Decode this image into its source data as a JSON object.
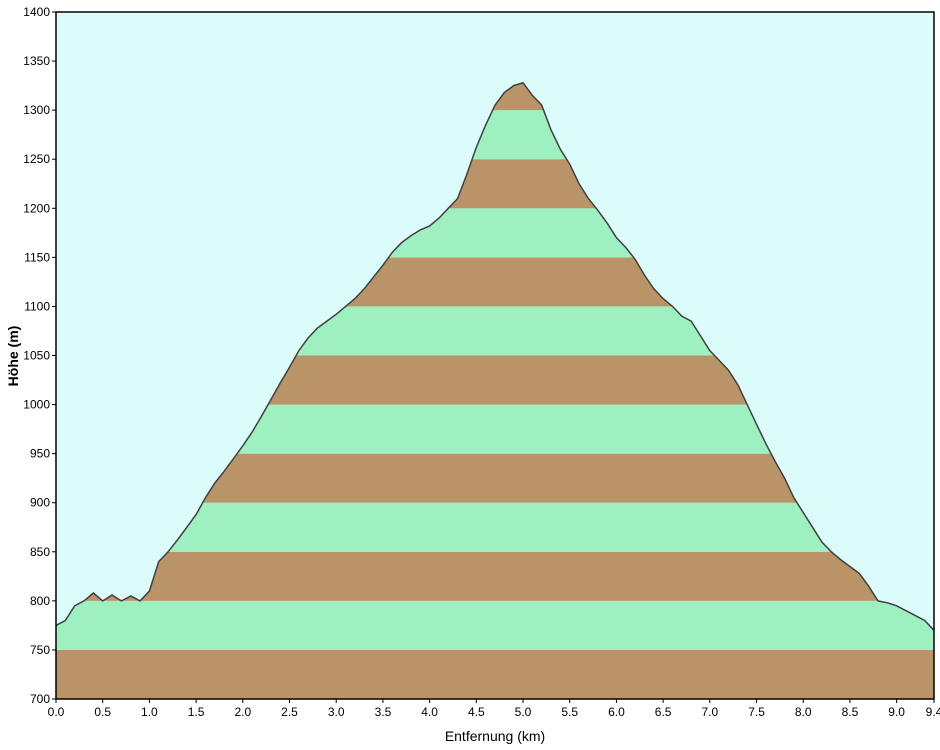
{
  "chart_data": {
    "type": "area",
    "xlabel": "Entfernung  (km)",
    "ylabel": "Höhe (m)",
    "xlim": [
      0,
      9.4
    ],
    "ylim": [
      700,
      1400
    ],
    "xticks": [
      0.0,
      0.5,
      1.0,
      1.5,
      2.0,
      2.5,
      3.0,
      3.5,
      4.0,
      4.5,
      5.0,
      5.5,
      6.0,
      6.5,
      7.0,
      7.5,
      8.0,
      8.5,
      9.0,
      9.4
    ],
    "xtick_labels": [
      "0.0",
      "0.5",
      "1.0",
      "1.5",
      "2.0",
      "2.5",
      "3.0",
      "3.5",
      "4.0",
      "4.5",
      "5.0",
      "5.5",
      "6.0",
      "6.5",
      "7.0",
      "7.5",
      "8.0",
      "8.5",
      "9.0",
      "9.4"
    ],
    "yticks": [
      700,
      750,
      800,
      850,
      900,
      950,
      1000,
      1050,
      1100,
      1150,
      1200,
      1250,
      1300,
      1350,
      1400
    ],
    "ytick_labels": [
      "700",
      "750",
      "800",
      "850",
      "900",
      "950",
      "1000",
      "1050",
      "1100",
      "1150",
      "1200",
      "1250",
      "1300",
      "1350",
      "1400"
    ],
    "band_interval": 50,
    "colors": {
      "background": "#dcfcfc",
      "band_brown": "#b89468",
      "band_green": "#9ef0c0",
      "line": "#404040",
      "axis": "#000000"
    },
    "x": [
      0.0,
      0.1,
      0.2,
      0.3,
      0.4,
      0.5,
      0.6,
      0.7,
      0.8,
      0.9,
      1.0,
      1.1,
      1.2,
      1.3,
      1.4,
      1.5,
      1.6,
      1.7,
      1.8,
      1.9,
      2.0,
      2.1,
      2.2,
      2.3,
      2.4,
      2.5,
      2.6,
      2.7,
      2.8,
      2.9,
      3.0,
      3.1,
      3.2,
      3.3,
      3.4,
      3.5,
      3.6,
      3.7,
      3.8,
      3.9,
      4.0,
      4.1,
      4.2,
      4.3,
      4.4,
      4.5,
      4.6,
      4.7,
      4.8,
      4.9,
      5.0,
      5.1,
      5.2,
      5.3,
      5.4,
      5.5,
      5.6,
      5.7,
      5.8,
      5.9,
      6.0,
      6.1,
      6.2,
      6.3,
      6.4,
      6.5,
      6.6,
      6.7,
      6.8,
      6.9,
      7.0,
      7.1,
      7.2,
      7.3,
      7.4,
      7.5,
      7.6,
      7.7,
      7.8,
      7.9,
      8.0,
      8.1,
      8.2,
      8.3,
      8.4,
      8.5,
      8.6,
      8.7,
      8.8,
      8.9,
      9.0,
      9.1,
      9.2,
      9.3,
      9.4
    ],
    "values": [
      775,
      780,
      795,
      800,
      808,
      800,
      806,
      800,
      805,
      800,
      810,
      840,
      850,
      862,
      875,
      888,
      905,
      920,
      932,
      945,
      958,
      972,
      988,
      1005,
      1022,
      1038,
      1055,
      1068,
      1078,
      1085,
      1092,
      1100,
      1108,
      1118,
      1130,
      1142,
      1155,
      1165,
      1172,
      1178,
      1182,
      1190,
      1200,
      1210,
      1235,
      1262,
      1285,
      1305,
      1318,
      1325,
      1328,
      1315,
      1305,
      1280,
      1260,
      1245,
      1225,
      1210,
      1198,
      1185,
      1170,
      1160,
      1148,
      1132,
      1118,
      1108,
      1100,
      1090,
      1085,
      1070,
      1055,
      1045,
      1035,
      1020,
      1000,
      980,
      960,
      942,
      925,
      905,
      890,
      875,
      860,
      850,
      842,
      835,
      828,
      815,
      800,
      798,
      795,
      790,
      785,
      780,
      770
    ]
  }
}
